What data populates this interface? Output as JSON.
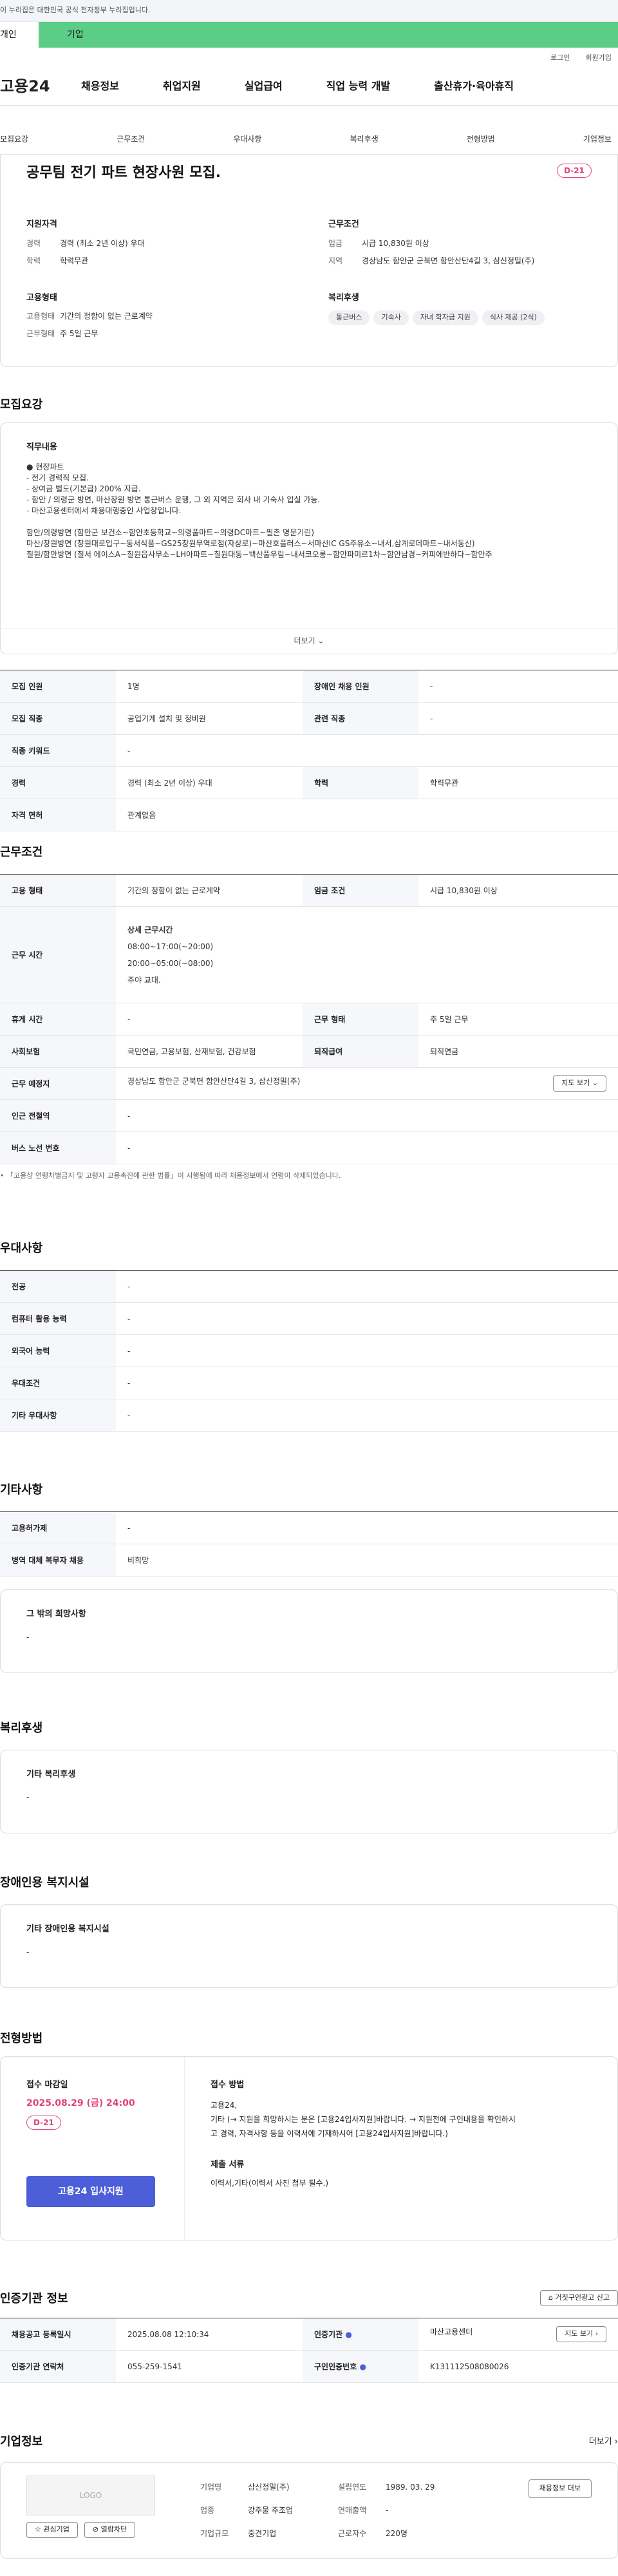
{
  "gov_bar": "이 누리집은 대한민국 공식 전자정부 누리집입니다.",
  "tabs": {
    "personal": "개인",
    "business": "기업"
  },
  "utils": {
    "login": "로그인",
    "join": "회원가입"
  },
  "gnb": {
    "logo": "고용24",
    "items": [
      "채용정보",
      "취업지원",
      "실업급여",
      "직업 능력 개발",
      "출산휴가·육아휴직"
    ]
  },
  "anchors": [
    "모집요강",
    "근무조건",
    "우대사항",
    "복리후생",
    "전형방법",
    "기업정보"
  ],
  "job": {
    "title": "공무팀 전기 파트 현장사원 모집.",
    "dday": "D-21",
    "qual": {
      "heading": "지원자격",
      "rows": [
        {
          "k": "경력",
          "v": "경력 (최소 2년 이상) 우대"
        },
        {
          "k": "학력",
          "v": "학력무관"
        }
      ]
    },
    "cond": {
      "heading": "근무조건",
      "rows": [
        {
          "k": "임금",
          "v": "시급 10,830원 이상"
        },
        {
          "k": "지역",
          "v": "경상남도 함안군 군북면 함안산단4길 3, 삼신정밀(주)"
        }
      ]
    },
    "emp": {
      "heading": "고용형태",
      "rows": [
        {
          "k": "고용형태",
          "v": "기간의 정함이 없는 근로계약"
        },
        {
          "k": "근무형태",
          "v": "주 5일 근무"
        }
      ]
    },
    "welfare": {
      "heading": "복리후생",
      "chips": [
        "통근버스",
        "기숙사",
        "자녀 학자금 지원",
        "식사 제공 (2식)"
      ]
    }
  },
  "recruit": {
    "title": "모집요강",
    "desc_heading": "직무내용",
    "desc_lines": [
      "● 현장파트",
      "- 전기 경력직 모집.",
      "- 상여금 별도(기본급) 200% 지급.",
      "- 함안 / 의령군 방면, 마산창원 방면 통근버스 운행, 그 외 지역은 회사 내 기숙사 입실 가능.",
      "- 마산고용센터에서 채용대행중인 사업장입니다.",
      "",
      "함안/의령방면 (함안군 보건소~함안초등학교~의령풀마트~의령DC마트~필촌 명문기린)",
      "마산/창원방면 (창원대로입구~동서식품~GS25창원무역로점(자상로)~마산호플러스~서마산IC GS주유소~내서,삼계로데마트~내서동신)",
      "칠원/함안방면 (칠서 에이스A~칠원읍사무소~LH아파트~칠원대동~백산풀우림~내서코오롱~함안파미르1차~함안남경~커피에반하다~함안주"
    ],
    "more": "더보기",
    "table": [
      [
        {
          "k": "모집 인원",
          "v": "1명"
        },
        {
          "k": "장애인 채용 인원",
          "v": "-"
        }
      ],
      [
        {
          "k": "모집 직종",
          "v": "공업기계 설치 및 정비원"
        },
        {
          "k": "관련 직종",
          "v": "-"
        }
      ],
      [
        {
          "k": "직종 키워드",
          "v": "-"
        }
      ],
      [
        {
          "k": "경력",
          "v": "경력 (최소 2년 이상) 우대"
        },
        {
          "k": "학력",
          "v": "학력무관"
        }
      ],
      [
        {
          "k": "자격 면허",
          "v": "관계없음"
        }
      ]
    ]
  },
  "work": {
    "title": "근무조건",
    "emp_type": {
      "k": "고용 형태",
      "v": "기간의 정함이 없는 근로계약"
    },
    "wage": {
      "k": "임금 조건",
      "v": "시급 10,830원 이상"
    },
    "hours": {
      "k": "근무 시간",
      "sub": "상세 근무시간",
      "lines": [
        "08:00~17:00(~20:00)",
        "20:00~05:00(~08:00)",
        "주야 교대."
      ]
    },
    "rest": {
      "k": "휴게 시간",
      "v": "-"
    },
    "form": {
      "k": "근무 형태",
      "v": "주 5일 근무"
    },
    "insurance": {
      "k": "사회보험",
      "v": "국민연금, 고용보험, 산재보험, 건강보험"
    },
    "retire": {
      "k": "퇴직급여",
      "v": "퇴직연금"
    },
    "place": {
      "k": "근무 예정지",
      "v": "경상남도 함안군 군북면 함안산단4길 3, 삼신정밀(주)",
      "btn": "지도 보기"
    },
    "subway": {
      "k": "인근 전철역",
      "v": "-"
    },
    "bus": {
      "k": "버스 노선 번호",
      "v": "-"
    },
    "note": "「고용상 연령차별금지 및 고령자 고용촉진에 관한 법률」이 시행됨에 따라 채용정보에서 연령이 삭제되었습니다."
  },
  "pref": {
    "title": "우대사항",
    "rows": [
      {
        "k": "전공",
        "v": "-"
      },
      {
        "k": "컴퓨터 활용 능력",
        "v": "-"
      },
      {
        "k": "외국어 능력",
        "v": "-"
      },
      {
        "k": "우대조건",
        "v": "-"
      },
      {
        "k": "기타 우대사항",
        "v": "-"
      }
    ]
  },
  "etc": {
    "title": "기타사항",
    "rows": [
      {
        "k": "고용허가제",
        "v": "-"
      },
      {
        "k": "병역 대체 복무자 채용",
        "v": "비희망"
      }
    ],
    "box_h": "그 밖의 희망사항",
    "box_v": "-"
  },
  "welfare": {
    "title": "복리후생",
    "box_h": "기타 복리후생",
    "box_v": "-"
  },
  "disabled": {
    "title": "장애인용 복지시설",
    "box_h": "기타 장애인용 복지시설",
    "box_v": "-"
  },
  "selection": {
    "title": "전형방법",
    "deadline_h": "접수 마감일",
    "deadline": "2025.08.29 (금) 24:00",
    "dday": "D-21",
    "apply_btn": "고용24 입사지원",
    "method_h": "접수 방법",
    "method_lines": [
      "고용24,",
      "기타 (→ 지원을 희망하시는 분은 [고용24입사지원]바랍니다. → 지원전에 구인내용을 확인하시",
      "고 경력, 자격사항 등을 이력서에 기재하시어 [고용24입사지원]바랍니다.)"
    ],
    "docs_h": "제출 서류",
    "docs": "이력서,기타(이력서 사진 첨부 필수.)"
  },
  "cert": {
    "title": "인증기관 정보",
    "report": "거짓구인광고 신고",
    "rows": [
      [
        {
          "k": "채용공고 등록일시",
          "v": "2025.08.08 12:10:34"
        },
        {
          "k": "인증기관",
          "v": "마산고용센터",
          "btn": "지도 보기"
        }
      ],
      [
        {
          "k": "인증기관 연락처",
          "v": "055-259-1541"
        },
        {
          "k": "구인인증번호",
          "v": "K131112508080026"
        }
      ]
    ]
  },
  "company": {
    "title": "기업정보",
    "more": "더보기",
    "logo": "LOGO",
    "fav": "관심기업",
    "block": "열람차단",
    "cols": [
      [
        {
          "k": "기업명",
          "v": "삼신정밀(주)"
        },
        {
          "k": "업종",
          "v": "강주물 주조업"
        },
        {
          "k": "기업규모",
          "v": "중견기업"
        }
      ],
      [
        {
          "k": "설립연도",
          "v": "1989. 03. 29"
        },
        {
          "k": "연매출액",
          "v": "-"
        },
        {
          "k": "근로자수",
          "v": "220명"
        }
      ]
    ],
    "ad_btn": "채용정보 더보"
  }
}
